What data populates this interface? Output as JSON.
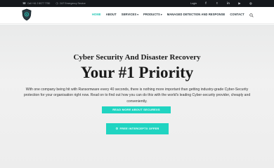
{
  "topbar": {
    "phone": "Call +61 2 8077 7780",
    "emergency": "24/7 Emergency Service",
    "login": "Login",
    "social": [
      "f",
      "t",
      "in",
      "▶",
      "◎"
    ]
  },
  "nav": {
    "items": [
      {
        "label": "HOME",
        "active": true,
        "dropdown": false
      },
      {
        "label": "ABOUT",
        "active": false,
        "dropdown": false
      },
      {
        "label": "SERVICES",
        "active": false,
        "dropdown": true
      },
      {
        "label": "PRODUCTS",
        "active": false,
        "dropdown": true
      },
      {
        "label": "MANAGED DETECTION AND RESPONSE",
        "active": false,
        "dropdown": false
      },
      {
        "label": "CONTACT",
        "active": false,
        "dropdown": false
      }
    ]
  },
  "hero": {
    "subtitle": "Cyber Security And Disaster Recovery",
    "title": "Your #1 Priority",
    "paragraph": "With one company being hit with Ransomware every 40 seconds, there is nothing more important than getting industry-grade Cyber-Security protection for your organisation right now. Read on to find out how you can do this with the world's leading Cyber-security provider, cheaply and conveniently.",
    "button_primary": "READ MORE ABOUT SECUREXS",
    "button_secondary": "FREE INTERCEPTX OFFER"
  },
  "colors": {
    "accent": "#20d4c1",
    "topbar": "#15181c",
    "nav_active": "#1fc5b3"
  }
}
